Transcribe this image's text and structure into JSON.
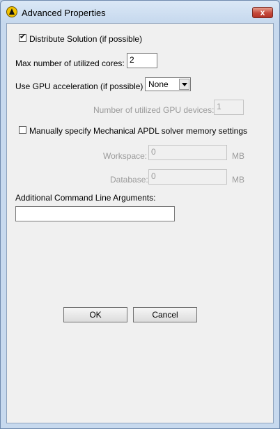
{
  "window": {
    "title": "Advanced Properties",
    "close_label": "x"
  },
  "options": {
    "distribute_label": "Distribute Solution (if possible)",
    "distribute_checked": true,
    "cores_label": "Max number of utilized cores:",
    "cores_value": "2",
    "gpu_label": "Use GPU acceleration (if possible)",
    "gpu_value": "None",
    "gpu_devices_label": "Number of utilized GPU devices:",
    "gpu_devices_value": "1",
    "memory_label": "Manually specify Mechanical APDL solver memory settings",
    "memory_checked": false,
    "workspace_label": "Workspace:",
    "workspace_value": "0",
    "workspace_unit": "MB",
    "database_label": "Database:",
    "database_value": "0",
    "database_unit": "MB",
    "args_label": "Additional Command Line Arguments:",
    "args_value": ""
  },
  "buttons": {
    "ok": "OK",
    "cancel": "Cancel"
  }
}
